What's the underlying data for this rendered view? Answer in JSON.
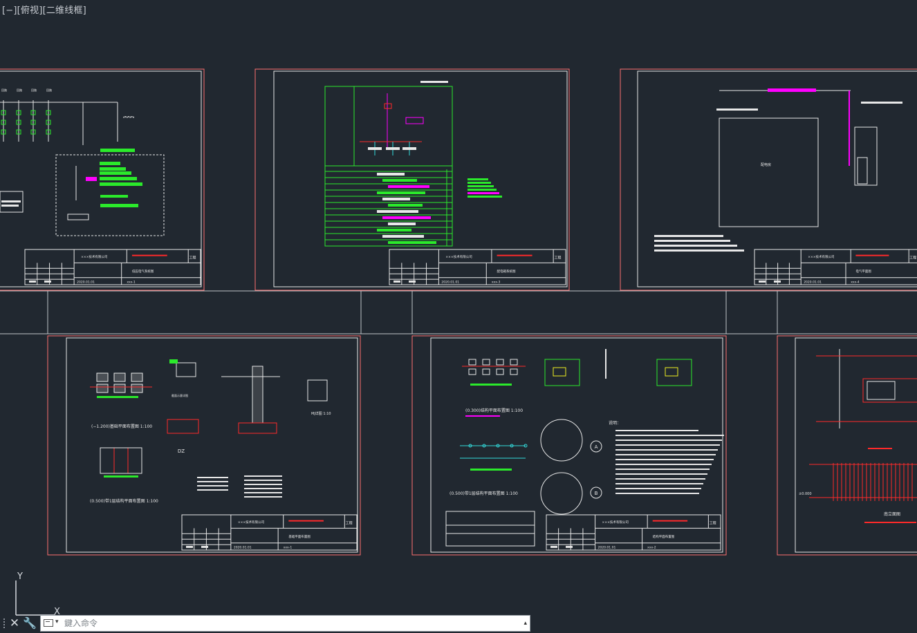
{
  "viewport": {
    "label": "[−][俯视][二维线框]"
  },
  "ucs": {
    "y_label": "Y",
    "x_label": "X"
  },
  "command_line": {
    "placeholder": "鍵入命令",
    "close_glyph": "✕",
    "customize_glyph": "🔧",
    "prompt_caret": "▾",
    "scroll_glyph": "▴"
  },
  "colors": {
    "background": "#212830",
    "sheet_border": "#ff7070",
    "frame": "#e8e8e8",
    "green": "#2bea2b",
    "magenta": "#ff00ff",
    "red": "#ff2a2a",
    "cyan": "#33dddd",
    "yellow": "#f0f020",
    "divider": "#bfc3c8"
  },
  "titleblock": {
    "company": "×××技术有限公司",
    "project": "工程",
    "date": "2020.01.01"
  },
  "sheets": [
    {
      "id": "electrical-system",
      "title": "低压电气系统图",
      "number": "xxx-1"
    },
    {
      "id": "distribution-box",
      "title": "配电箱系统图",
      "number": "xxx-3"
    },
    {
      "id": "electrical-plan",
      "title": "电气平面图",
      "number": "xxx-4"
    },
    {
      "id": "foundation-plan",
      "title": "基础平面布置图",
      "number": "xxx-1"
    },
    {
      "id": "structural-plan",
      "title": "结构平面布置图",
      "number": "xxx-2"
    },
    {
      "id": "elevation",
      "title": "立面图",
      "number": ""
    }
  ],
  "annotations": {
    "plan_neg_1200": "(−1.200)基础平面布置图  1:100",
    "plan_0500_left": "(0.500)带1层结构平面布置图  1:100",
    "plan_0300": "(0.300)结构平面布置图  1:100",
    "plan_0500_right": "(0.500)带1层结构平面布置图  1:100",
    "dz_label": "DZ",
    "mj_label": "MJ详图  1:10",
    "notes_title": "说明：",
    "facade_label": "南立面图",
    "bubble_a": "A",
    "bubble_b": "B",
    "elev_1": "±0.000"
  }
}
